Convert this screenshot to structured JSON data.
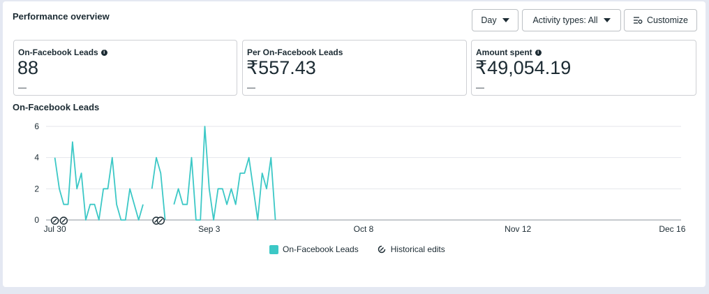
{
  "panel": {
    "title": "Performance overview"
  },
  "toolbar": {
    "day_label": "Day",
    "activity_label": "Activity types: All",
    "customize_label": "Customize"
  },
  "metrics": [
    {
      "label": "On-Facebook Leads",
      "value": "88",
      "delta": "—",
      "info": true
    },
    {
      "label": "Per On-Facebook Leads",
      "value": "₹557.43",
      "delta": "—",
      "info": false
    },
    {
      "label": "Amount spent",
      "value": "₹49,054.19",
      "delta": "—",
      "info": true
    }
  ],
  "chart_title": "On-Facebook Leads",
  "legend": {
    "series": "On-Facebook Leads",
    "edits": "Historical edits"
  },
  "colors": {
    "series": "#3cc8c6",
    "grid": "#e4e6eb",
    "text": "#1c2b33"
  },
  "chart_data": {
    "type": "line",
    "title": "On-Facebook Leads",
    "x_ticks": [
      "Jul 30",
      "Sep 3",
      "Oct 8",
      "Nov 12",
      "Dec 16"
    ],
    "x_tick_index": [
      0,
      35,
      70,
      105,
      140
    ],
    "y_ticks": [
      0,
      2,
      4,
      6
    ],
    "ylim": [
      0,
      6
    ],
    "xlim_index": [
      -2,
      142
    ],
    "series": [
      {
        "name": "On-Facebook Leads",
        "start_index": 0,
        "values": [
          4,
          2,
          1,
          1,
          5,
          2,
          3,
          0,
          1,
          1,
          0,
          2,
          2,
          4,
          1,
          0,
          0,
          2,
          1,
          0,
          1,
          null,
          2,
          4,
          3,
          0,
          null,
          1,
          2,
          1,
          1,
          4,
          0,
          0,
          6,
          2,
          0,
          2,
          2,
          1,
          2,
          1,
          3,
          3,
          4,
          2,
          0,
          3,
          2,
          4,
          0
        ]
      }
    ],
    "historical_edit_markers_index": [
      0,
      2,
      23,
      24
    ]
  }
}
